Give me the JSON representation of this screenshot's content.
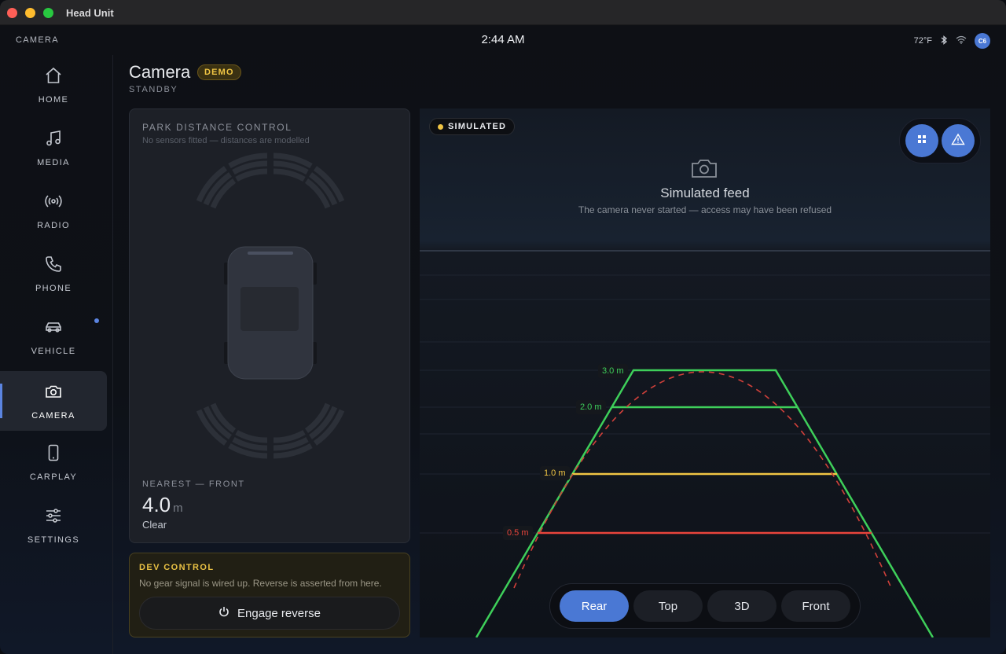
{
  "window": {
    "title": "Head Unit"
  },
  "status": {
    "section": "CAMERA",
    "clock": "2:44 AM",
    "temp": "72°F",
    "avatar": "C6"
  },
  "nav": [
    {
      "id": "home",
      "label": "HOME"
    },
    {
      "id": "media",
      "label": "MEDIA"
    },
    {
      "id": "radio",
      "label": "RADIO"
    },
    {
      "id": "phone",
      "label": "PHONE"
    },
    {
      "id": "vehicle",
      "label": "VEHICLE"
    },
    {
      "id": "camera",
      "label": "CAMERA"
    },
    {
      "id": "carplay",
      "label": "CARPLAY"
    },
    {
      "id": "settings",
      "label": "SETTINGS"
    }
  ],
  "page": {
    "title": "Camera",
    "badge": "DEMO",
    "subtitle": "STANDBY"
  },
  "pdc": {
    "title": "PARK DISTANCE CONTROL",
    "subtitle": "No sensors fitted — distances are modelled",
    "nearest_label": "NEAREST — FRONT",
    "nearest_value": "4.0",
    "nearest_unit": "m",
    "nearest_status": "Clear"
  },
  "dev": {
    "title": "DEV CONTROL",
    "subtitle": "No gear signal is wired up. Reverse is asserted from here.",
    "button": "Engage reverse"
  },
  "camera": {
    "badge": "SIMULATED",
    "feed_title": "Simulated feed",
    "feed_subtitle": "The camera never started — access may have been refused",
    "distance_labels": [
      {
        "text": "3.0 m",
        "color": "#3ecf5a"
      },
      {
        "text": "2.0 m",
        "color": "#3ecf5a"
      },
      {
        "text": "1.0 m",
        "color": "#f0c544"
      },
      {
        "text": "0.5 m",
        "color": "#e8453c"
      }
    ],
    "views": [
      "Rear",
      "Top",
      "3D",
      "Front"
    ],
    "active_view": "Rear"
  },
  "colors": {
    "accent": "#4a78d4",
    "warning": "#f0c544",
    "danger": "#e8453c",
    "safe": "#3ecf5a"
  }
}
